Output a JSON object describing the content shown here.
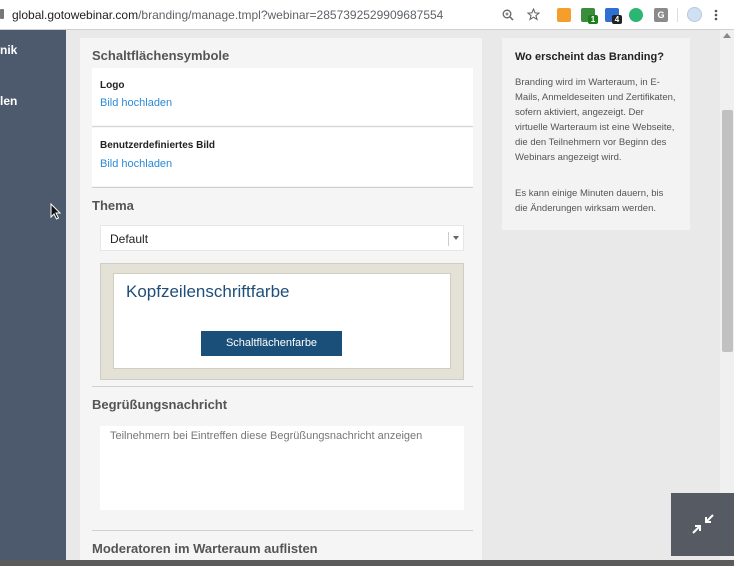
{
  "browser": {
    "url_host": "global.gotowebinar.com",
    "url_path": "/branding/manage.tmpl?webinar=2857392529909687554",
    "icons": [
      "zoom-icon",
      "star-icon",
      "extension-icon",
      "extension-badge-icon",
      "extension-badge-icon",
      "extension-icon",
      "extension-icon",
      "profile-icon",
      "menu-icon"
    ],
    "badge_1": "1",
    "badge_2": "4",
    "ext_g": "G"
  },
  "sidebar": {
    "items": [
      {
        "label": "nik"
      },
      {
        "label": "len"
      }
    ]
  },
  "main": {
    "buttons_section": {
      "title": "Schaltflächensymbole",
      "logo_label": "Logo",
      "logo_link": "Bild hochladen",
      "custom_label": "Benutzerdefiniertes Bild",
      "custom_link": "Bild hochladen"
    },
    "theme_section": {
      "title": "Thema",
      "selected": "Default",
      "preview_header": "Kopfzeilenschriftfarbe",
      "preview_button": "Schaltflächenfarbe"
    },
    "greeting_section": {
      "title": "Begrüßungsnachricht",
      "placeholder": "Teilnehmern bei Eintreffen diese Begrüßungsnachricht anzeigen"
    },
    "moderators_section": {
      "title": "Moderatoren im Warteraum auflisten"
    }
  },
  "info_panel": {
    "title": "Wo erscheint das Branding?",
    "paragraph1": "Branding wird im Warteraum, in E-Mails, Anmeldeseiten und Zertifikaten, sofern aktiviert, angezeigt. Der virtuelle Warteraum ist eine Webseite, die den Teilnehmern vor Beginn des Webinars angezeigt wird.",
    "paragraph2": "Es kann einige Minuten dauern, bis die Änderungen wirksam werden."
  },
  "colors": {
    "sidebar": "#4d5a6e",
    "link": "#2b8ad6",
    "preview_header": "#1f4e79",
    "preview_button": "#1a4f7a"
  }
}
